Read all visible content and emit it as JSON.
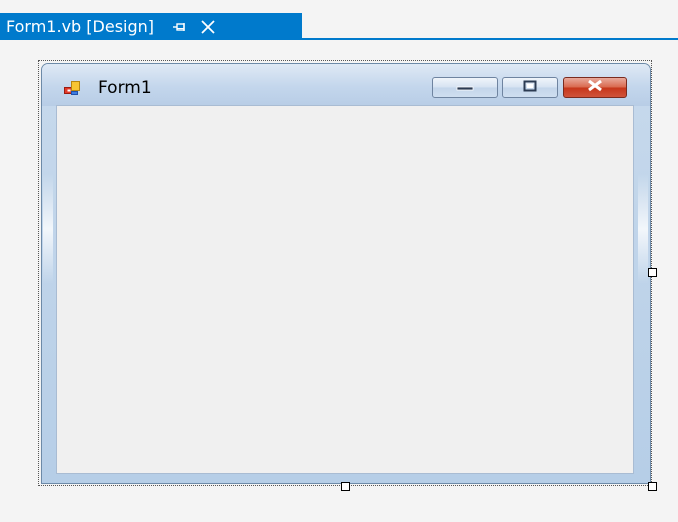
{
  "document_tab": {
    "title": "Form1.vb [Design]",
    "pin_icon": "pin-icon",
    "close_icon": "close-icon"
  },
  "form": {
    "title": "Form1",
    "icon": "form-icon",
    "buttons": {
      "minimize_icon": "minimize-icon",
      "maximize_icon": "maximize-icon",
      "close_icon": "close-icon"
    }
  },
  "colors": {
    "tab_accent": "#007acc",
    "client_background": "#f0f0f0",
    "close_button": "#c6361b"
  }
}
